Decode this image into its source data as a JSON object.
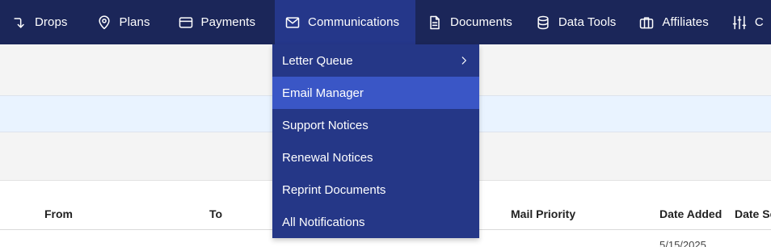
{
  "nav": {
    "items": [
      {
        "label": "Drops",
        "icon": "arrow-turn-down-icon"
      },
      {
        "label": "Plans",
        "icon": "map-pin-icon"
      },
      {
        "label": "Payments",
        "icon": "credit-card-icon"
      },
      {
        "label": "Communications",
        "icon": "mail-icon"
      },
      {
        "label": "Documents",
        "icon": "document-icon"
      },
      {
        "label": "Data Tools",
        "icon": "database-icon"
      },
      {
        "label": "Affiliates",
        "icon": "briefcase-icon"
      },
      {
        "label": "C",
        "icon": "sliders-icon"
      }
    ],
    "active": "Communications"
  },
  "dropdown": {
    "items": [
      {
        "label": "Letter Queue",
        "has_submenu": true
      },
      {
        "label": "Email Manager",
        "hovered": true
      },
      {
        "label": "Support Notices"
      },
      {
        "label": "Renewal Notices"
      },
      {
        "label": "Reprint Documents"
      },
      {
        "label": "All Notifications"
      }
    ]
  },
  "table": {
    "headers": {
      "from": "From",
      "to": "To",
      "mail_priority": "Mail Priority",
      "date_added": "Date Added",
      "date_sent": "Date Se"
    },
    "rows": [
      {
        "date_added": "5/15/2025"
      }
    ]
  },
  "colors": {
    "nav_bg": "#1b2659",
    "nav_active": "#25378a",
    "dropdown_bg": "#253787",
    "dropdown_hover": "#3a56c6",
    "info_band": "#e9f3ff"
  }
}
